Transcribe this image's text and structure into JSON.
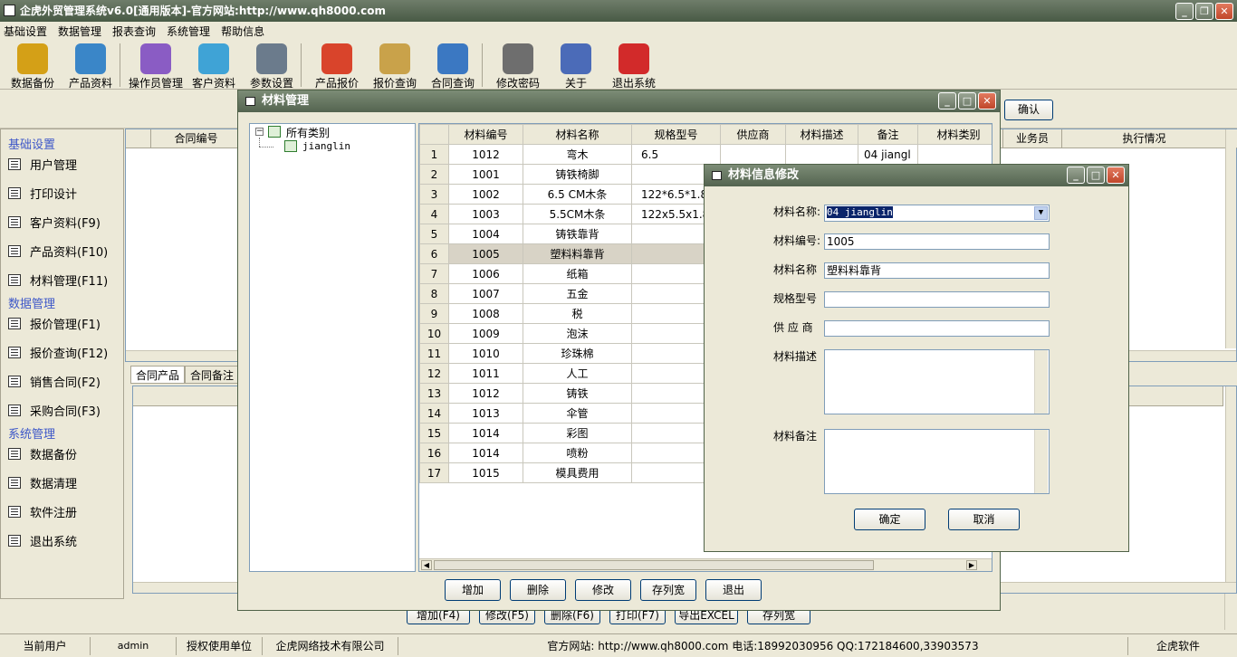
{
  "app": {
    "title": "企虎外贸管理系统v6.0[通用版本]-官方网站:http://www.qh8000.com"
  },
  "menu": [
    "基础设置",
    "数据管理",
    "报表查询",
    "系统管理",
    "帮助信息"
  ],
  "toolbar": [
    {
      "label": "数据备份",
      "icon": "database-backup-icon",
      "color": "#d4a017"
    },
    {
      "label": "产品资料",
      "icon": "product-info-icon",
      "color": "#3a86c8"
    },
    {
      "label": "操作员管理",
      "icon": "operator-icon",
      "color": "#8a5cc4"
    },
    {
      "label": "客户资料",
      "icon": "customer-icon",
      "color": "#3fa3d6"
    },
    {
      "label": "参数设置",
      "icon": "settings-db-icon",
      "color": "#6b7b8c"
    },
    {
      "label": "产品报价",
      "icon": "quote-icon",
      "color": "#d9442b"
    },
    {
      "label": "报价查询",
      "icon": "magnifier-icon",
      "color": "#c9a24a"
    },
    {
      "label": "合同查询",
      "icon": "contract-icon",
      "color": "#3b78c2"
    },
    {
      "label": "修改密码",
      "icon": "key-icon",
      "color": "#6e6e6e"
    },
    {
      "label": "关于",
      "icon": "about-icon",
      "color": "#4b6bb8"
    },
    {
      "label": "退出系统",
      "icon": "exit-icon",
      "color": "#d22a2a"
    }
  ],
  "sidebar": [
    {
      "section": "基础设置",
      "items": [
        "用户管理",
        "打印设计",
        "客户资料(F9)",
        "产品资料(F10)",
        "材料管理(F11)"
      ]
    },
    {
      "section": "数据管理",
      "items": [
        "报价管理(F1)",
        "报价查询(F12)",
        "销售合同(F2)",
        "采购合同(F3)"
      ]
    },
    {
      "section": "系统管理",
      "items": [
        "数据备份",
        "数据清理",
        "软件注册",
        "退出系统"
      ]
    }
  ],
  "background": {
    "confirm_label": "确认",
    "header_col1": "合同编号",
    "header_right": [
      "业务员",
      "执行情况"
    ],
    "tabs": [
      "合同产品",
      "合同备注"
    ],
    "bottom_buttons": [
      "增加(F4)",
      "修改(F5)",
      "删除(F6)",
      "打印(F7)",
      "导出EXCEL",
      "存列宽"
    ]
  },
  "material_window": {
    "title": "材料管理",
    "tree_root": "所有类别",
    "tree_child": "jianglin",
    "columns": [
      "材料编号",
      "材料名称",
      "规格型号",
      "供应商",
      "材料描述",
      "备注",
      "材料类别"
    ],
    "rows": [
      {
        "no": "1",
        "code": "1012",
        "name": "弯木",
        "spec": "6.5",
        "cat": "04 jiangl"
      },
      {
        "no": "2",
        "code": "1001",
        "name": "铸铁椅脚",
        "spec": "",
        "cat": ""
      },
      {
        "no": "3",
        "code": "1002",
        "name": "6.5 CM木条",
        "spec": "122*6.5*1.8 CM",
        "cat": ""
      },
      {
        "no": "4",
        "code": "1003",
        "name": "5.5CM木条",
        "spec": "122x5.5x1.8 CM",
        "cat": ""
      },
      {
        "no": "5",
        "code": "1004",
        "name": "铸铁靠背",
        "spec": "",
        "cat": ""
      },
      {
        "no": "6",
        "code": "1005",
        "name": "塑料料靠背",
        "spec": "",
        "cat": ""
      },
      {
        "no": "7",
        "code": "1006",
        "name": "纸箱",
        "spec": "",
        "cat": ""
      },
      {
        "no": "8",
        "code": "1007",
        "name": "五金",
        "spec": "",
        "cat": ""
      },
      {
        "no": "9",
        "code": "1008",
        "name": "税",
        "spec": "",
        "cat": ""
      },
      {
        "no": "10",
        "code": "1009",
        "name": "泡沫",
        "spec": "",
        "cat": ""
      },
      {
        "no": "11",
        "code": "1010",
        "name": "珍珠棉",
        "spec": "",
        "cat": ""
      },
      {
        "no": "12",
        "code": "1011",
        "name": "人工",
        "spec": "",
        "cat": ""
      },
      {
        "no": "13",
        "code": "1012",
        "name": "铸铁",
        "spec": "",
        "cat": ""
      },
      {
        "no": "14",
        "code": "1013",
        "name": "伞管",
        "spec": "",
        "cat": ""
      },
      {
        "no": "15",
        "code": "1014",
        "name": "彩图",
        "spec": "",
        "cat": ""
      },
      {
        "no": "16",
        "code": "1014",
        "name": "喷粉",
        "spec": "",
        "cat": ""
      },
      {
        "no": "17",
        "code": "1015",
        "name": "模具费用",
        "spec": "",
        "cat": ""
      }
    ],
    "selected_row": 5,
    "buttons": [
      "增加",
      "删除",
      "修改",
      "存列宽",
      "退出"
    ]
  },
  "edit_dialog": {
    "title": "材料信息修改",
    "labels": {
      "category": "材料名称:",
      "code": "材料编号:",
      "name": "材料名称",
      "spec": "规格型号",
      "supplier": "供 应 商",
      "desc": "材料描述",
      "note": "材料备注"
    },
    "values": {
      "category": "04   jianglin",
      "code": "1005",
      "name": "塑料料靠背",
      "spec": "",
      "supplier": "",
      "desc": "",
      "note": ""
    },
    "ok_label": "确定",
    "cancel_label": "取消"
  },
  "status": {
    "current_user_label": "当前用户",
    "current_user": "admin",
    "licensee_label": "授权使用单位",
    "licensee": "企虎网络技术有限公司",
    "contact": "官方网站: http://www.qh8000.com 电话:18992030956 QQ:172184600,33903573",
    "brand": "企虎软件"
  }
}
